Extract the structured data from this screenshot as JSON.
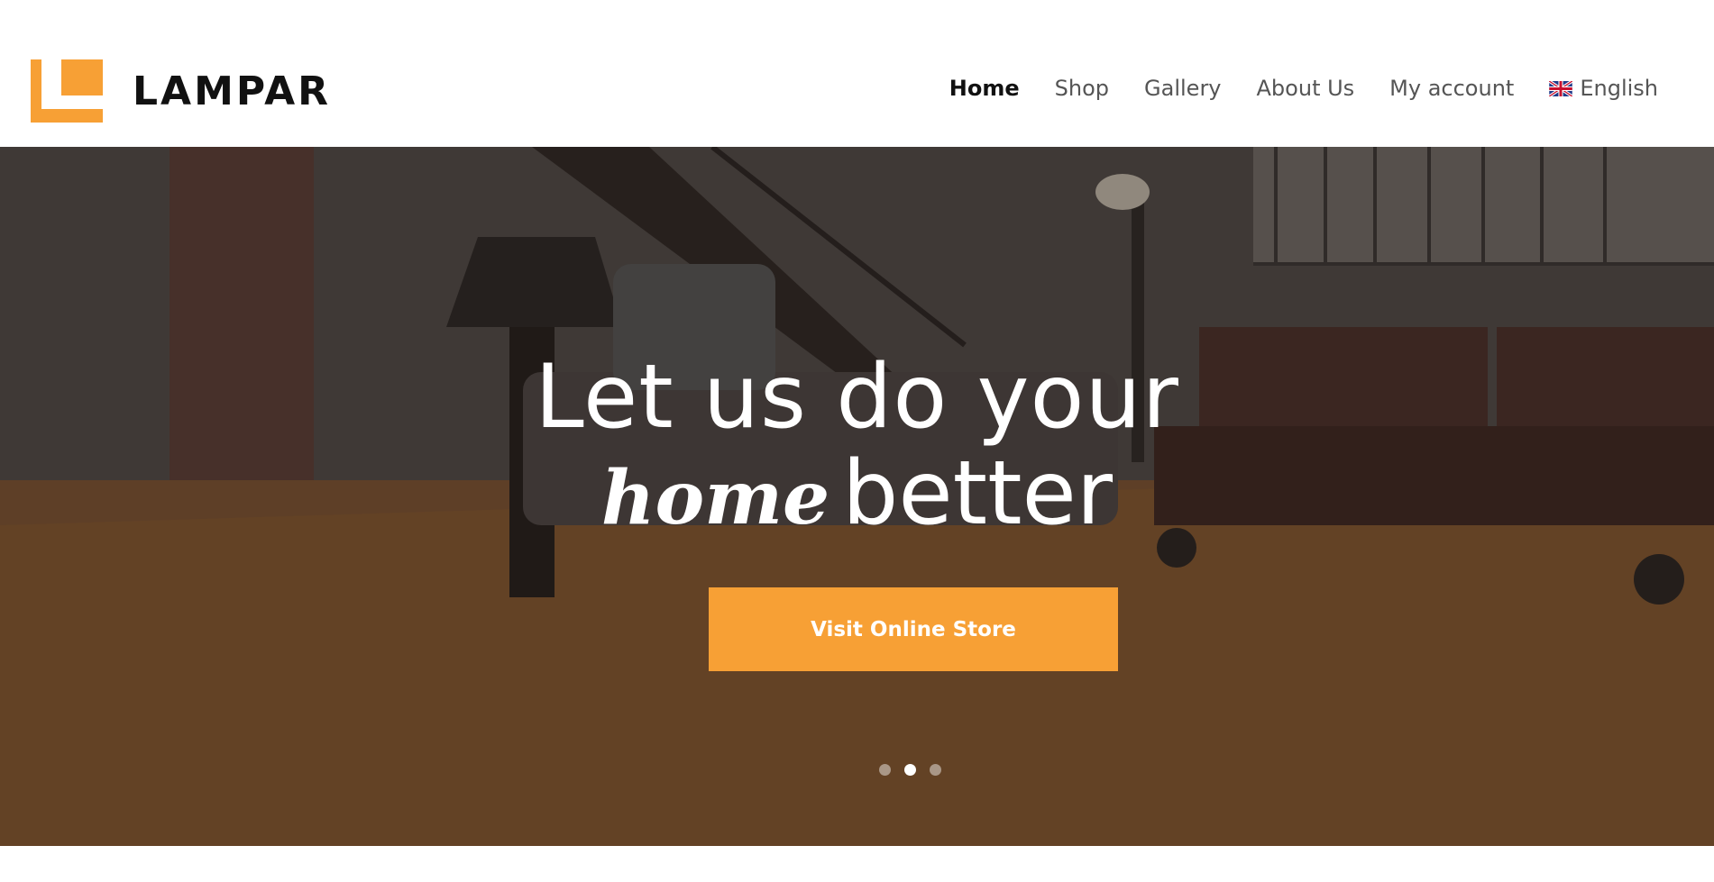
{
  "brand": {
    "name": "LAMPAR",
    "accent_color": "#f7a035"
  },
  "nav": {
    "items": [
      {
        "label": "Home",
        "active": true
      },
      {
        "label": "Shop",
        "active": false
      },
      {
        "label": "Gallery",
        "active": false
      },
      {
        "label": "About Us",
        "active": false
      },
      {
        "label": "My account",
        "active": false
      }
    ],
    "language": {
      "label": "English",
      "icon": "uk-flag-icon"
    }
  },
  "hero": {
    "headline_line1": "Let us do your",
    "headline_script": "home",
    "headline_rest": "better",
    "cta_label": "Visit Online Store",
    "slides": {
      "count": 3,
      "active_index": 1
    }
  }
}
